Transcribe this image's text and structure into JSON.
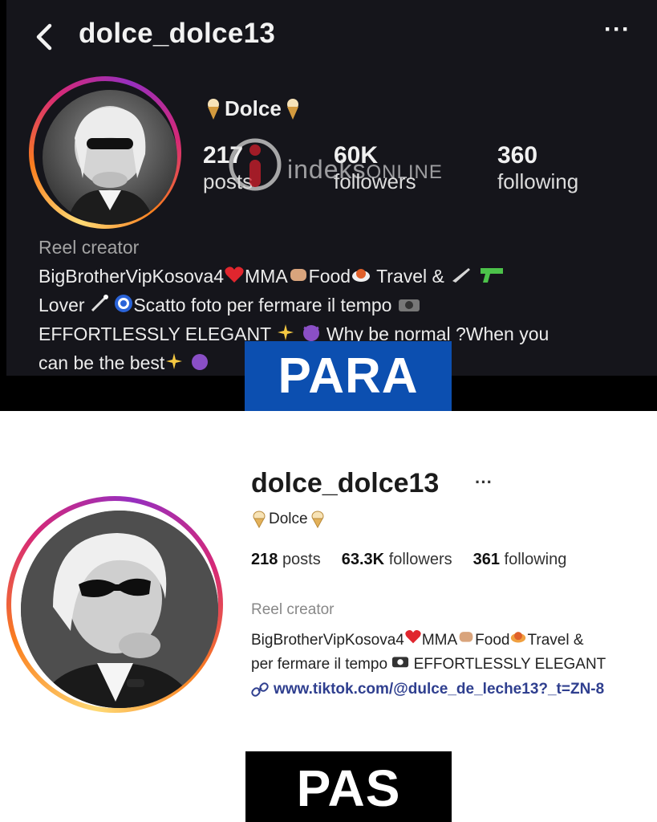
{
  "before": {
    "username": "dolce_dolce13",
    "more_label": "···",
    "display_name": "Dolce",
    "stats": {
      "posts_value": "217",
      "posts_label": "posts",
      "followers_value": "60K",
      "followers_label": "followers",
      "following_value": "360",
      "following_label": "following"
    },
    "watermark": {
      "main": "indeks",
      "sub": "ONLINE"
    },
    "category": "Reel creator",
    "bio": {
      "l1_a": "BigBrotherVipKosova4",
      "l1_b": "MMA",
      "l1_c": "Food",
      "l1_d": "Travel &",
      "l2_a": "Lover",
      "l2_b": "Scatto foto per fermare il tempo",
      "l3_a": "EFFORTLESSLY ELEGANT",
      "l3_b": "Why be normal ?When you",
      "l4_a": "can be the best"
    },
    "badge": "PARA"
  },
  "after": {
    "username": "dolce_dolce13",
    "more_label": "···",
    "display_name": "Dolce",
    "stats": {
      "posts_value": "218",
      "posts_label": "posts",
      "followers_value": "63.3K",
      "followers_label": "followers",
      "following_value": "361",
      "following_label": "following"
    },
    "category": "Reel creator",
    "bio": {
      "l1_a": "BigBrotherVipKosova4",
      "l1_b": "MMA",
      "l1_c": "Food",
      "l1_d": "Travel &",
      "l2_a": "per fermare il tempo",
      "l2_b": "EFFORTLESSLY ELEGANT"
    },
    "link": "www.tiktok.com/@dulce_de_leche13?_t=ZN-8",
    "badge": "PAS"
  },
  "colors": {
    "dark_bg": "#15151b",
    "para_badge": "#0c4fb0",
    "pas_badge": "#000000",
    "link": "#2f3f8f"
  }
}
